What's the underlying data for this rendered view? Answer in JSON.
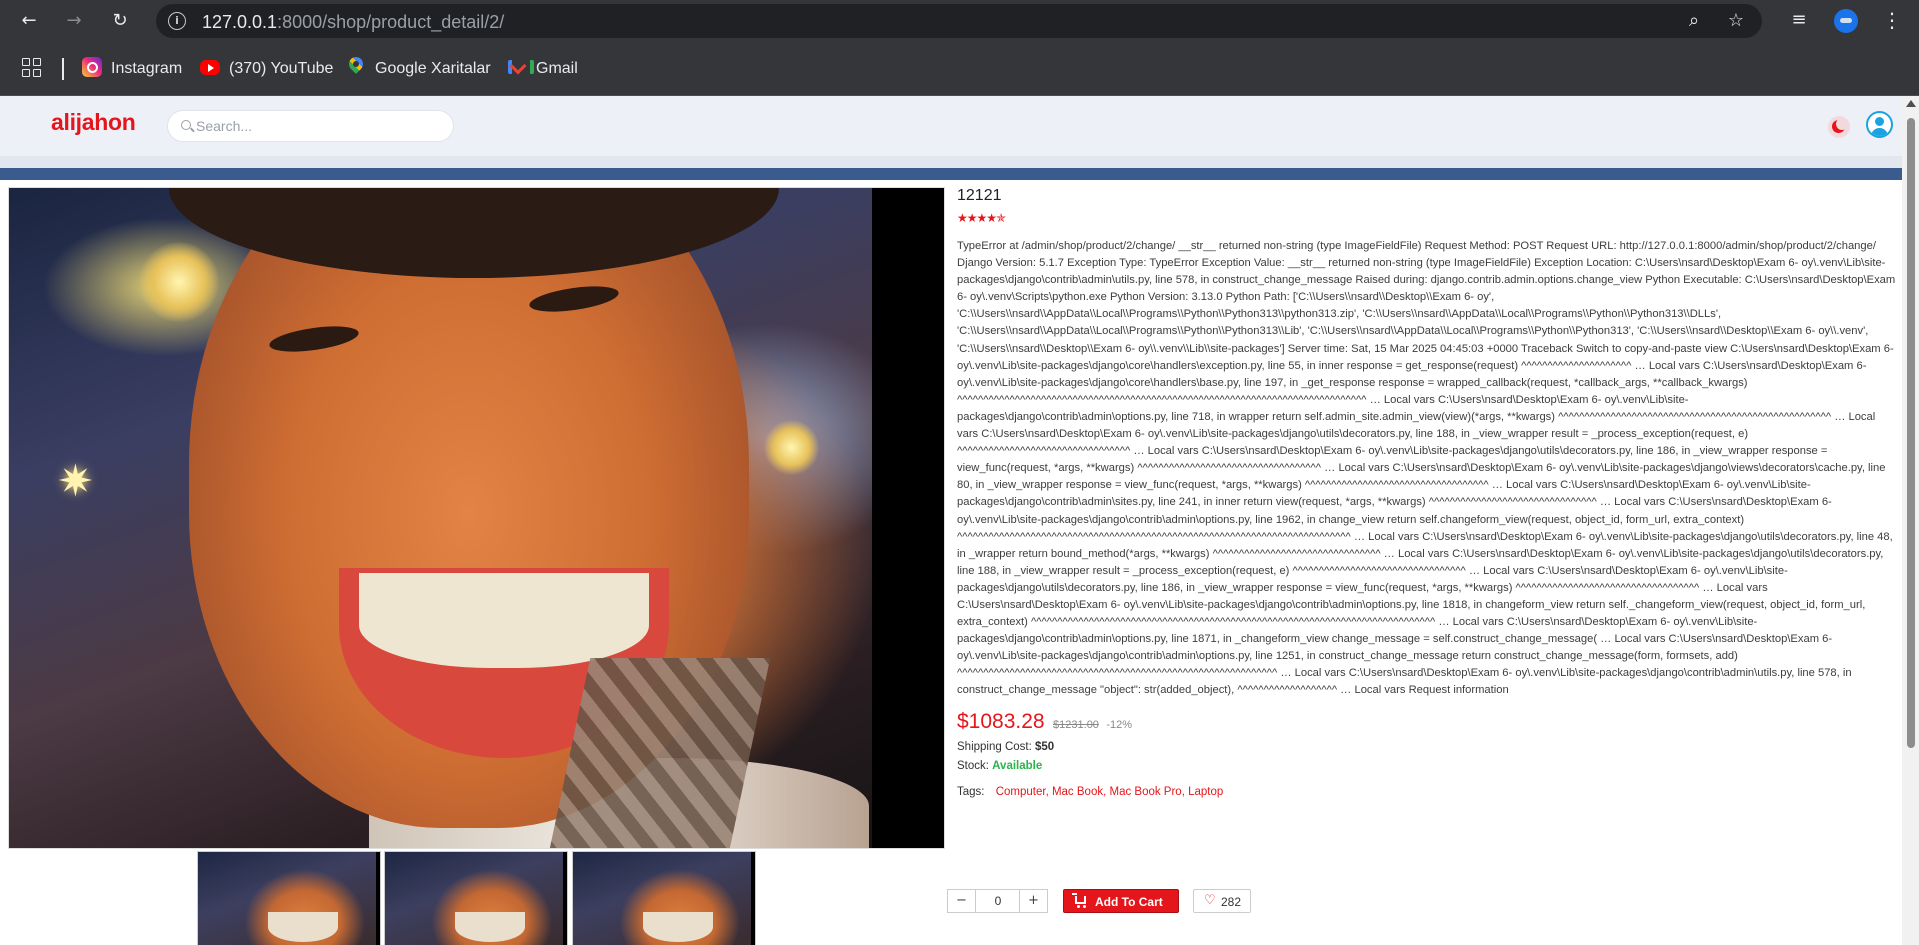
{
  "browser": {
    "url_host": "127.0.0.1",
    "url_rest": ":8000/shop/product_detail/2/",
    "icons": [
      "back-arrow-icon",
      "forward-arrow-icon",
      "reload-icon",
      "site-info-icon",
      "zoom-icon",
      "bookmark-star-icon",
      "media-controls-icon",
      "profile-icon",
      "kebab-menu-icon"
    ],
    "bookmarks": [
      {
        "label": "Instagram",
        "icon": "instagram-icon"
      },
      {
        "label": "(370) YouTube",
        "icon": "youtube-icon"
      },
      {
        "label": "Google Xaritalar",
        "icon": "google-maps-icon"
      },
      {
        "label": "Gmail",
        "icon": "gmail-icon"
      }
    ]
  },
  "site": {
    "logo": "alijahon",
    "search_placeholder": "Search...",
    "colors": {
      "brand": "#e4161b",
      "nav": "#3a5b8d",
      "available": "#2ab34a"
    }
  },
  "product": {
    "title": "12121",
    "rating_stars": "★★★★✯",
    "description": "TypeError at /admin/shop/product/2/change/ __str__ returned non-string (type ImageFieldFile) Request Method: POST Request URL: http://127.0.0.1:8000/admin/shop/product/2/change/ Django Version: 5.1.7 Exception Type: TypeError Exception Value: __str__ returned non-string (type ImageFieldFile) Exception Location: C:\\Users\\nsard\\Desktop\\Exam 6- oy\\.venv\\Lib\\site-packages\\django\\contrib\\admin\\utils.py, line 578, in construct_change_message Raised during: django.contrib.admin.options.change_view Python Executable: C:\\Users\\nsard\\Desktop\\Exam 6- oy\\.venv\\Scripts\\python.exe Python Version: 3.13.0 Python Path: ['C:\\\\Users\\\\nsard\\\\Desktop\\\\Exam 6- oy', 'C:\\\\Users\\\\nsard\\\\AppData\\\\Local\\\\Programs\\\\Python\\\\Python313\\\\python313.zip', 'C:\\\\Users\\\\nsard\\\\AppData\\\\Local\\\\Programs\\\\Python\\\\Python313\\\\DLLs', 'C:\\\\Users\\\\nsard\\\\AppData\\\\Local\\\\Programs\\\\Python\\\\Python313\\\\Lib', 'C:\\\\Users\\\\nsard\\\\AppData\\\\Local\\\\Programs\\\\Python\\\\Python313', 'C:\\\\Users\\\\nsard\\\\Desktop\\\\Exam 6- oy\\\\.venv', 'C:\\\\Users\\\\nsard\\\\Desktop\\\\Exam 6- oy\\\\.venv\\\\Lib\\\\site-packages'] Server time: Sat, 15 Mar 2025 04:45:03 +0000 Traceback Switch to copy-and-paste view C:\\Users\\nsard\\Desktop\\Exam 6- oy\\.venv\\Lib\\site-packages\\django\\core\\handlers\\exception.py, line 55, in inner response = get_response(request) ^^^^^^^^^^^^^^^^^^^^^ … Local vars C:\\Users\\nsard\\Desktop\\Exam 6- oy\\.venv\\Lib\\site-packages\\django\\core\\handlers\\base.py, line 197, in _get_response response = wrapped_callback(request, *callback_args, **callback_kwargs) ^^^^^^^^^^^^^^^^^^^^^^^^^^^^^^^^^^^^^^^^^^^^^^^^^^^^^^^^^^^^^^^^^^^^^^^^^^^^^^ … Local vars C:\\Users\\nsard\\Desktop\\Exam 6- oy\\.venv\\Lib\\site-packages\\django\\contrib\\admin\\options.py, line 718, in wrapper return self.admin_site.admin_view(view)(*args, **kwargs) ^^^^^^^^^^^^^^^^^^^^^^^^^^^^^^^^^^^^^^^^^^^^^^^^^^^^ … Local vars C:\\Users\\nsard\\Desktop\\Exam 6- oy\\.venv\\Lib\\site-packages\\django\\utils\\decorators.py, line 188, in _view_wrapper result = _process_exception(request, e) ^^^^^^^^^^^^^^^^^^^^^^^^^^^^^^^^^ … Local vars C:\\Users\\nsard\\Desktop\\Exam 6- oy\\.venv\\Lib\\site-packages\\django\\utils\\decorators.py, line 186, in _view_wrapper response = view_func(request, *args, **kwargs) ^^^^^^^^^^^^^^^^^^^^^^^^^^^^^^^^^^^ … Local vars C:\\Users\\nsard\\Desktop\\Exam 6- oy\\.venv\\Lib\\site-packages\\django\\views\\decorators\\cache.py, line 80, in _view_wrapper response = view_func(request, *args, **kwargs) ^^^^^^^^^^^^^^^^^^^^^^^^^^^^^^^^^^^ … Local vars C:\\Users\\nsard\\Desktop\\Exam 6- oy\\.venv\\Lib\\site-packages\\django\\contrib\\admin\\sites.py, line 241, in inner return view(request, *args, **kwargs) ^^^^^^^^^^^^^^^^^^^^^^^^^^^^^^^^ … Local vars C:\\Users\\nsard\\Desktop\\Exam 6- oy\\.venv\\Lib\\site-packages\\django\\contrib\\admin\\options.py, line 1962, in change_view return self.changeform_view(request, object_id, form_url, extra_context) ^^^^^^^^^^^^^^^^^^^^^^^^^^^^^^^^^^^^^^^^^^^^^^^^^^^^^^^^^^^^^^^^^^^^^^^^^^^ … Local vars C:\\Users\\nsard\\Desktop\\Exam 6- oy\\.venv\\Lib\\site-packages\\django\\utils\\decorators.py, line 48, in _wrapper return bound_method(*args, **kwargs) ^^^^^^^^^^^^^^^^^^^^^^^^^^^^^^^^ … Local vars C:\\Users\\nsard\\Desktop\\Exam 6- oy\\.venv\\Lib\\site-packages\\django\\utils\\decorators.py, line 188, in _view_wrapper result = _process_exception(request, e) ^^^^^^^^^^^^^^^^^^^^^^^^^^^^^^^^^ … Local vars C:\\Users\\nsard\\Desktop\\Exam 6- oy\\.venv\\Lib\\site-packages\\django\\utils\\decorators.py, line 186, in _view_wrapper response = view_func(request, *args, **kwargs) ^^^^^^^^^^^^^^^^^^^^^^^^^^^^^^^^^^^ … Local vars C:\\Users\\nsard\\Desktop\\Exam 6- oy\\.venv\\Lib\\site-packages\\django\\contrib\\admin\\options.py, line 1818, in changeform_view return self._changeform_view(request, object_id, form_url, extra_context) ^^^^^^^^^^^^^^^^^^^^^^^^^^^^^^^^^^^^^^^^^^^^^^^^^^^^^^^^^^^^^^^^^^^^^^^^^^^^^ … Local vars C:\\Users\\nsard\\Desktop\\Exam 6- oy\\.venv\\Lib\\site-packages\\django\\contrib\\admin\\options.py, line 1871, in _changeform_view change_message = self.construct_change_message( … Local vars C:\\Users\\nsard\\Desktop\\Exam 6- oy\\.venv\\Lib\\site-packages\\django\\contrib\\admin\\options.py, line 1251, in construct_change_message return construct_change_message(form, formsets, add) ^^^^^^^^^^^^^^^^^^^^^^^^^^^^^^^^^^^^^^^^^^^^^^^^^^^^^^^^^^^^^ … Local vars C:\\Users\\nsard\\Desktop\\Exam 6- oy\\.venv\\Lib\\site-packages\\django\\contrib\\admin\\utils.py, line 578, in construct_change_message \"object\": str(added_object), ^^^^^^^^^^^^^^^^^^^ … Local vars Request information",
    "price": "$1083.28",
    "old_price": "$1231.00",
    "discount": "-12%",
    "shipping_label": "Shipping Cost:",
    "shipping_value": "$50",
    "stock_label": "Stock:",
    "stock_value": "Available",
    "tags_label": "Tags:",
    "tags": [
      "Computer",
      "Mac Book",
      "Mac Book Pro",
      "Laptop"
    ],
    "quantity": "0",
    "qty_minus": "−",
    "qty_plus": "+",
    "add_to_cart": "Add To Cart",
    "wishlist_count": "282",
    "thumbnail_count": 3
  }
}
